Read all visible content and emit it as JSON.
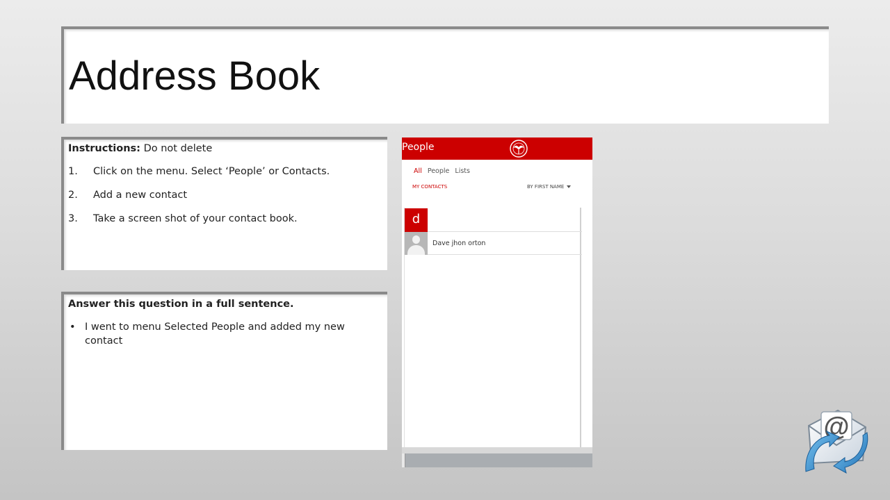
{
  "slide": {
    "title": "Address Book"
  },
  "instructions": {
    "label": "Instructions:",
    "note": " Do not delete",
    "steps": [
      {
        "num": "1.",
        "text": "Click on the menu. Select ‘People’ or Contacts."
      },
      {
        "num": "2.",
        "text": "Add a new contact"
      },
      {
        "num": "3.",
        "text": "Take a screen shot of your contact book."
      }
    ]
  },
  "answer": {
    "heading": "Answer this question in a full sentence.",
    "bullet": "•",
    "text": "I went to menu Selected People and added my new contact"
  },
  "screenshot": {
    "header_title": "People",
    "tabs": [
      "All",
      "People",
      "Lists"
    ],
    "active_tab": "All",
    "section_label": "MY CONTACTS",
    "sort_label": "BY FIRST NAME",
    "group_letter": "d",
    "contacts": [
      {
        "name": "Dave jhon orton"
      }
    ],
    "accent_color": "#cc0000"
  },
  "icons": {
    "email": "email-at-envelope-icon",
    "avatar": "person-placeholder-icon",
    "sort": "caret-down-icon",
    "crest": "school-crest-icon"
  }
}
